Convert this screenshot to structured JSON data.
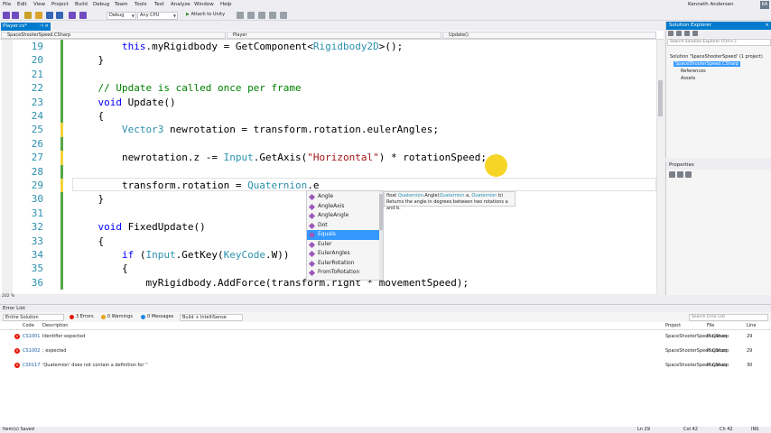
{
  "menu": [
    "File",
    "Edit",
    "View",
    "Project",
    "Build",
    "Debug",
    "Team",
    "Tools",
    "Test",
    "Analyze",
    "Window",
    "Help"
  ],
  "user": {
    "name": "Kenneth Andersen",
    "initials": "KA"
  },
  "toolbar": {
    "config": "Debug",
    "platform": "Any CPU",
    "attach": "Attach to Unity"
  },
  "doc_tab": "Player.cs*",
  "navbar": {
    "project": "SpaceShooterSpeed.CSharp",
    "class": "Player",
    "member": "Update()"
  },
  "code_lines": [
    {
      "num": "19",
      "indent": "        ",
      "parts": [
        [
          "kw",
          "this"
        ],
        [
          "",
          ".myRigidbody = GetComponent<"
        ],
        [
          "type",
          "Rigidbody2D"
        ],
        [
          "",
          ">();"
        ]
      ]
    },
    {
      "num": "20",
      "indent": "    ",
      "parts": [
        [
          "",
          "}"
        ]
      ]
    },
    {
      "num": "21",
      "indent": "",
      "parts": []
    },
    {
      "num": "22",
      "indent": "    ",
      "parts": [
        [
          "cm",
          "// Update is called once per frame"
        ]
      ]
    },
    {
      "num": "23",
      "indent": "    ",
      "parts": [
        [
          "kw",
          "void"
        ],
        [
          "",
          " Update()"
        ]
      ]
    },
    {
      "num": "24",
      "indent": "    ",
      "parts": [
        [
          "",
          "{"
        ]
      ]
    },
    {
      "num": "25",
      "indent": "        ",
      "parts": [
        [
          "type",
          "Vector3"
        ],
        [
          "",
          " newrotation = transform.rotation.eulerAngles;"
        ]
      ]
    },
    {
      "num": "26",
      "indent": "",
      "parts": []
    },
    {
      "num": "27",
      "indent": "        ",
      "parts": [
        [
          "",
          "newrotation.z -= "
        ],
        [
          "type",
          "Input"
        ],
        [
          "",
          ".GetAxis("
        ],
        [
          "str",
          "\"Horizontal\""
        ],
        [
          "",
          ") * rotationSpeed;"
        ]
      ]
    },
    {
      "num": "28",
      "indent": "",
      "parts": []
    },
    {
      "num": "29",
      "indent": "        ",
      "parts": [
        [
          "",
          "transform.rotation = "
        ],
        [
          "type",
          "Quaternion"
        ],
        [
          "",
          ".e"
        ]
      ]
    },
    {
      "num": "30",
      "indent": "    ",
      "parts": [
        [
          "",
          "}"
        ]
      ]
    },
    {
      "num": "31",
      "indent": "",
      "parts": []
    },
    {
      "num": "32",
      "indent": "    ",
      "parts": [
        [
          "kw",
          "void"
        ],
        [
          "",
          " FixedUpdate()"
        ]
      ]
    },
    {
      "num": "33",
      "indent": "    ",
      "parts": [
        [
          "",
          "{"
        ]
      ]
    },
    {
      "num": "34",
      "indent": "        ",
      "parts": [
        [
          "kw",
          "if"
        ],
        [
          "",
          " ("
        ],
        [
          "type",
          "Input"
        ],
        [
          "",
          ".GetKey("
        ],
        [
          "type",
          "KeyCode"
        ],
        [
          "",
          ".W))"
        ]
      ]
    },
    {
      "num": "35",
      "indent": "        ",
      "parts": [
        [
          "",
          "{"
        ]
      ]
    },
    {
      "num": "36",
      "indent": "            ",
      "parts": [
        [
          "",
          "myRigidbody.AddForce(transform.right * movementSpeed);"
        ]
      ]
    }
  ],
  "zoom": "202 %",
  "intellisense": {
    "items": [
      "Angle",
      "AngleAxis",
      "AngleAngle",
      "Dot",
      "Equals",
      "Euler",
      "EulerAngles",
      "EulerRotation",
      "FromToRotation"
    ],
    "selected_index": 4
  },
  "tooltip": {
    "sig_pre": "float ",
    "sig_type": "Quaternion",
    "sig_mid": ".Angle(",
    "sig_p1": "Quaternion",
    "sig_p1n": " a, ",
    "sig_p2": "Quaternion",
    "sig_p2n": " b)",
    "desc": "Returns the angle in degrees between two rotations a and b."
  },
  "solution": {
    "title": "Solution Explorer",
    "search_placeholder": "Search Solution Explorer (Ctrl+;)",
    "root": "Solution 'SpaceShooterSpeed' (1 project)",
    "project": "SpaceShooterSpeed.CSharp",
    "children": [
      "References",
      "Assets"
    ]
  },
  "properties": {
    "title": "Properties"
  },
  "errors": {
    "title": "Error List",
    "scope": "Entire Solution",
    "count_errors": "3 Errors",
    "count_warnings": "0 Warnings",
    "count_messages": "0 Messages",
    "build": "Build + IntelliSense",
    "search_placeholder": "Search Error List",
    "headers": {
      "code": "Code",
      "desc": "Description",
      "proj": "Project",
      "file": "File",
      "line": "Line"
    },
    "rows": [
      {
        "code": "CS1001",
        "desc": "Identifier expected",
        "proj": "SpaceShooterSpeed.CSharp",
        "file": "Player.cs",
        "line": "29"
      },
      {
        "code": "CS1002",
        "desc": "; expected",
        "proj": "SpaceShooterSpeed.CSharp",
        "file": "Player.cs",
        "line": "29"
      },
      {
        "code": "CS0117",
        "desc": "'Quaternion' does not contain a definition for ''",
        "proj": "SpaceShooterSpeed.CSharp",
        "file": "Player.cs",
        "line": "30"
      }
    ]
  },
  "status": {
    "left": "Item(s) Saved",
    "ln": "Ln 29",
    "col": "Col 42",
    "ch": "Ch 42",
    "mode": "INS"
  },
  "colors": {
    "accent": "#007acc",
    "error": "#e51400",
    "changed": "#f2d33b",
    "saved": "#57a64a",
    "selection": "#3399ff"
  }
}
